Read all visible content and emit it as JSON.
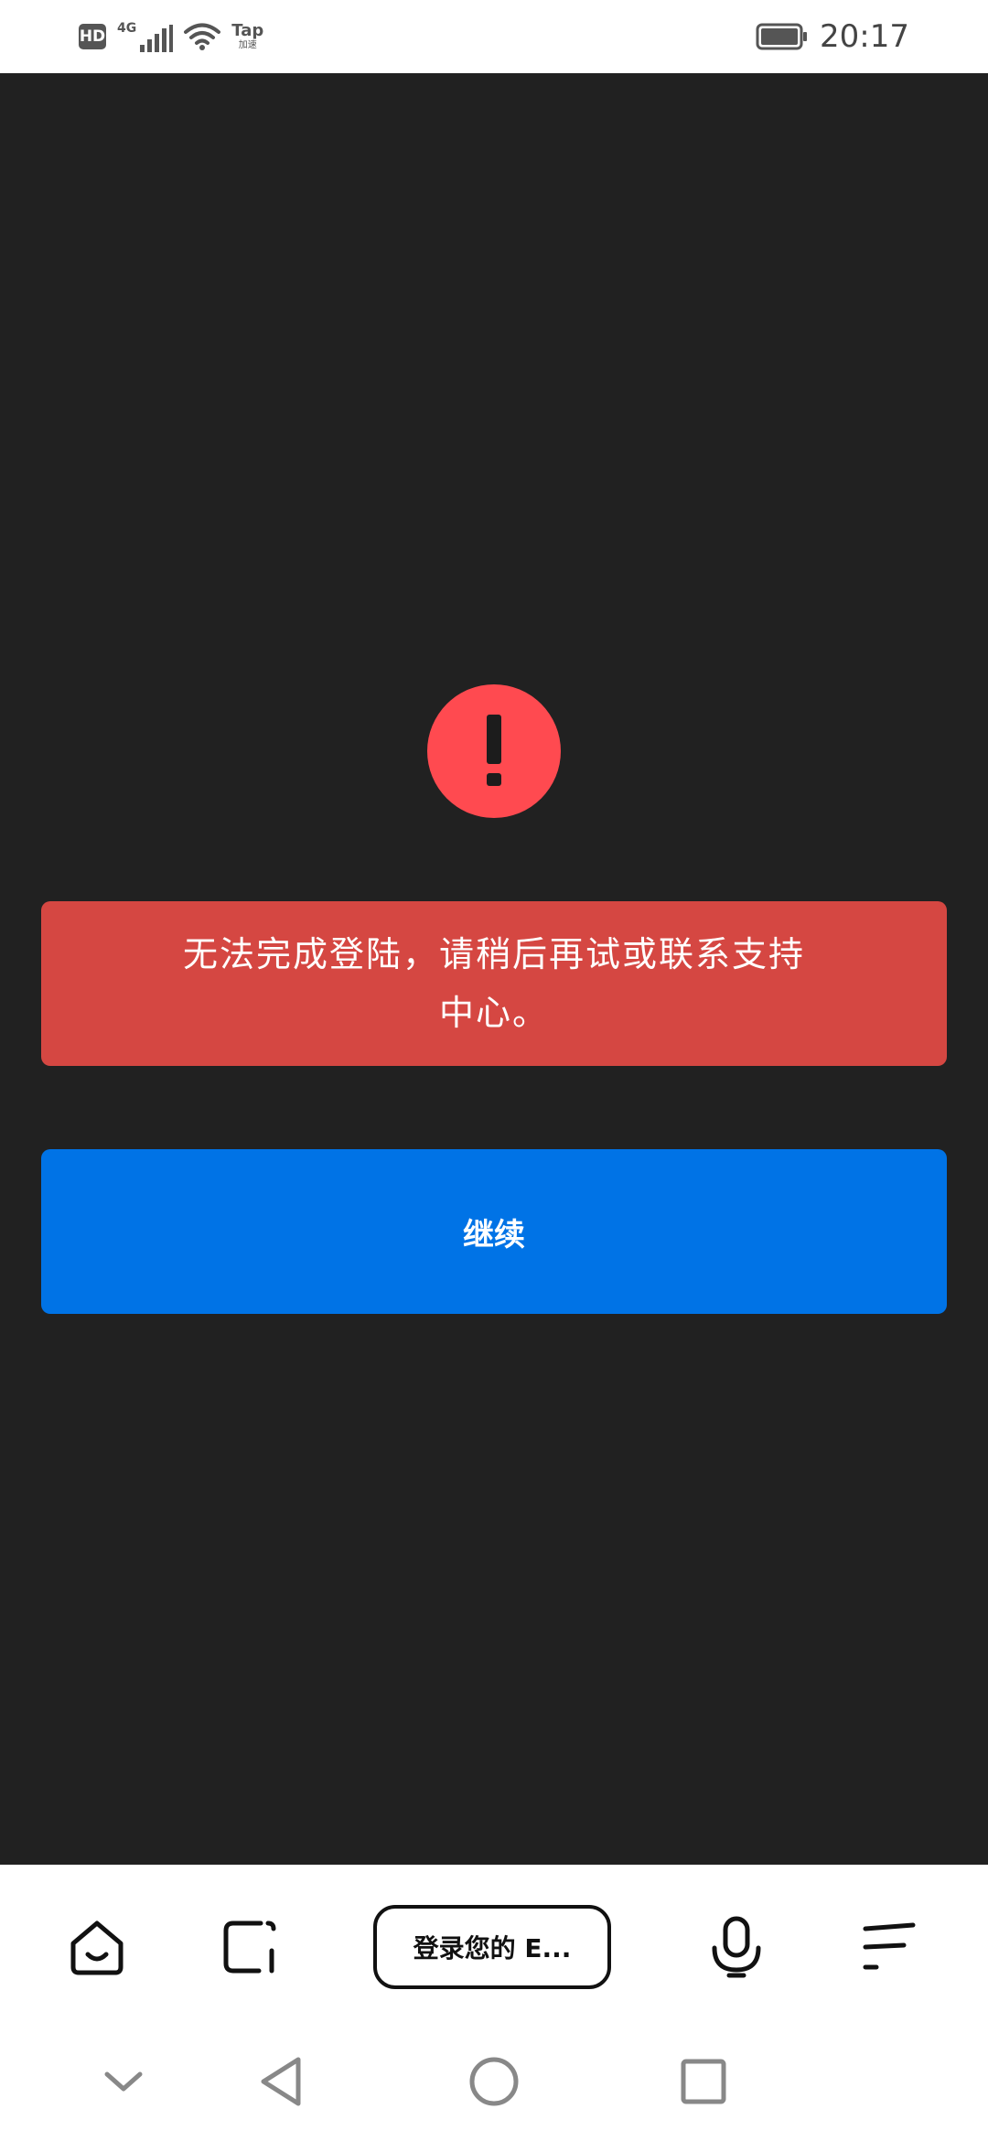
{
  "status_bar": {
    "hd_label": "HD",
    "network_label": "4G",
    "tap_label": "Tap",
    "tap_sub_label": "加速",
    "time": "20:17"
  },
  "alert": {
    "icon": "exclamation-icon",
    "color": "#ff4a50"
  },
  "error_message": {
    "text": "无法完成登陆，请稍后再试或联系支持中心。",
    "background": "#d54742"
  },
  "continue_button": {
    "label": "继续",
    "background": "#0073e6"
  },
  "toolbar": {
    "address_text": "登录您的 E...",
    "icons": [
      "home-icon",
      "tabs-icon",
      "microphone-icon",
      "menu-icon"
    ]
  },
  "nav_bar": {
    "icons": [
      "chevron-down-icon",
      "back-icon",
      "home-circle-icon",
      "recents-icon"
    ]
  }
}
